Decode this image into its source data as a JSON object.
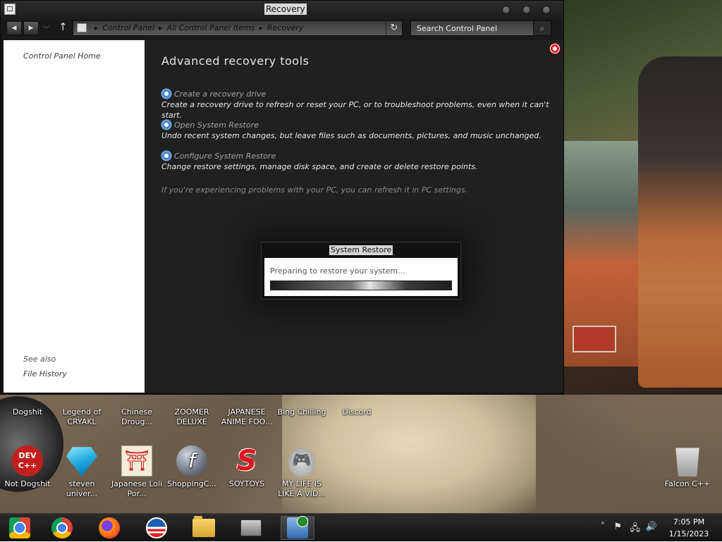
{
  "window": {
    "title": "Recovery",
    "breadcrumbs": [
      "Control Panel",
      "All Control Panel Items",
      "Recovery"
    ],
    "search_placeholder": "Search Control Panel"
  },
  "sidebar": {
    "home_label": "Control Panel Home",
    "see_also_label": "See also",
    "see_also_items": [
      "File History"
    ]
  },
  "main": {
    "heading": "Advanced recovery tools",
    "tools": [
      {
        "label": "Create a recovery drive",
        "description": "Create a recovery drive to refresh or reset your PC, or to troubleshoot problems, even when it can't start."
      },
      {
        "label": "Open System Restore",
        "description": "Undo recent system changes, but leave files such as documents, pictures, and music unchanged."
      },
      {
        "label": "Configure System Restore",
        "description": "Change restore settings, manage disk space, and create or delete restore points."
      }
    ],
    "refresh_note": "If you're experiencing problems with your PC, you can refresh it in PC settings."
  },
  "dialog": {
    "title": "System Restore",
    "message": "Preparing to restore your system...",
    "progress": 1.0
  },
  "desktop_icons_row1": [
    {
      "label": "Dogshit",
      "icon": "desktop-shortcut-icon"
    },
    {
      "label": "Legend of CRYAKL",
      "icon": "game-icon"
    },
    {
      "label": "Chinese Droug...",
      "icon": "app-icon"
    },
    {
      "label": "ZOOMER DELUXE",
      "icon": "app-icon"
    },
    {
      "label": "JAPANESE ANIME FOO...",
      "icon": "app-icon"
    },
    {
      "label": "Bing Chilling",
      "icon": "app-icon"
    },
    {
      "label": "Discord",
      "icon": "discord-icon"
    }
  ],
  "desktop_icons_row2": [
    {
      "label": "Not Dogshit",
      "icon_text": "DEV C++",
      "icon": "devcpp-icon"
    },
    {
      "label": "steven univer...",
      "icon": "diamond-icon"
    },
    {
      "label": "Japanese Loli Por...",
      "icon_text": "⛩",
      "icon": "torii-icon"
    },
    {
      "label": "ShoppingC...",
      "icon_text": "f",
      "icon": "flash-icon"
    },
    {
      "label": "SOYTOYS",
      "icon_text": "S",
      "icon": "s-logo-icon"
    },
    {
      "label": "MY LIFE IS LIKE A VID...",
      "icon_text": "🎮",
      "icon": "gamepad-icon"
    }
  ],
  "recycle_bin": {
    "label": "Falcon C++",
    "icon": "recycle-bin-icon"
  },
  "taskbar": {
    "apps": [
      {
        "name": "chrome-packaged-app",
        "icon": "chrome-app-icon"
      },
      {
        "name": "chrome",
        "icon": "chrome-icon"
      },
      {
        "name": "firefox",
        "icon": "firefox-icon"
      },
      {
        "name": "obama-logo",
        "icon": "obama-logo-icon"
      },
      {
        "name": "file-explorer",
        "icon": "folder-icon"
      },
      {
        "name": "store",
        "icon": "store-icon"
      },
      {
        "name": "system-restore",
        "icon": "system-restore-icon",
        "active": true
      }
    ],
    "tray_icons": [
      "chevron-up-icon",
      "flag-icon",
      "network-icon",
      "volume-icon"
    ],
    "time": "7:05 PM",
    "date": "1/15/2023"
  }
}
